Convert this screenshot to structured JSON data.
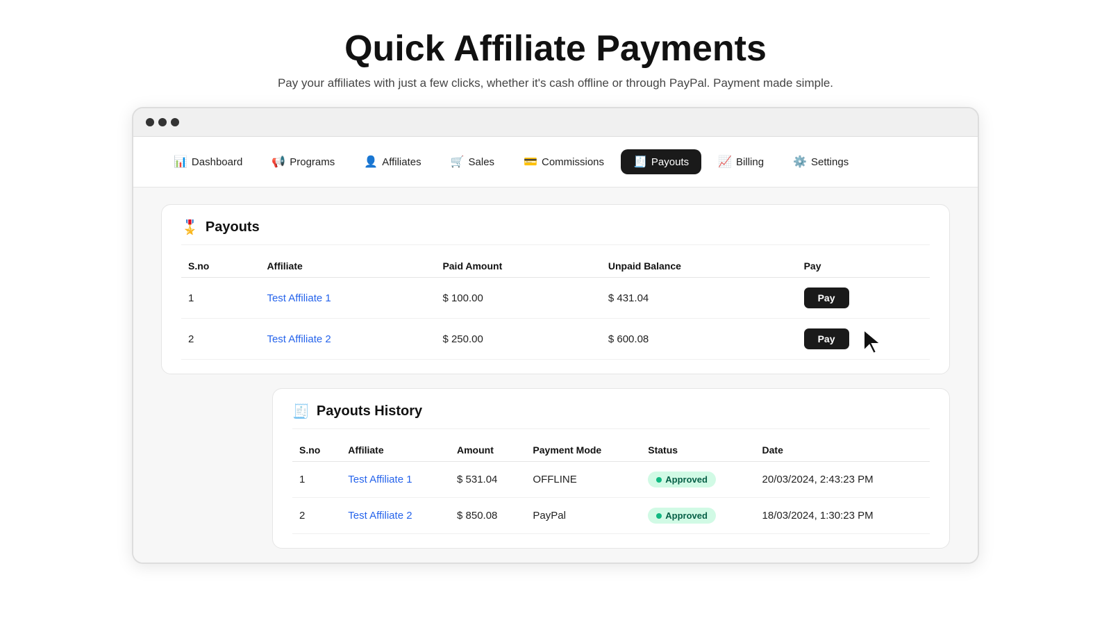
{
  "header": {
    "title": "Quick Affiliate Payments",
    "subtitle": "Pay your affiliates with just a few clicks, whether it's cash offline or through PayPal. Payment made simple."
  },
  "nav": {
    "items": [
      {
        "id": "dashboard",
        "label": "Dashboard",
        "icon": "📊",
        "active": false
      },
      {
        "id": "programs",
        "label": "Programs",
        "icon": "📢",
        "active": false
      },
      {
        "id": "affiliates",
        "label": "Affiliates",
        "icon": "👤",
        "active": false
      },
      {
        "id": "sales",
        "label": "Sales",
        "icon": "🛒",
        "active": false
      },
      {
        "id": "commissions",
        "label": "Commissions",
        "icon": "💳",
        "active": false
      },
      {
        "id": "payouts",
        "label": "Payouts",
        "icon": "🧾",
        "active": true
      },
      {
        "id": "billing",
        "label": "Billing",
        "icon": "📈",
        "active": false
      },
      {
        "id": "settings",
        "label": "Settings",
        "icon": "⚙️",
        "active": false
      }
    ]
  },
  "payouts": {
    "section_title": "Payouts",
    "columns": [
      "S.no",
      "Affiliate",
      "Paid Amount",
      "Unpaid Balance",
      "Pay"
    ],
    "rows": [
      {
        "sno": "1",
        "affiliate": "Test Affiliate 1",
        "affiliate_href": "#",
        "paid_amount": "$ 100.00",
        "unpaid_balance": "$ 431.04",
        "pay_label": "Pay"
      },
      {
        "sno": "2",
        "affiliate": "Test Affiliate 2",
        "affiliate_href": "#",
        "paid_amount": "$ 250.00",
        "unpaid_balance": "$ 600.08",
        "pay_label": "Pay"
      }
    ]
  },
  "payouts_history": {
    "section_title": "Payouts History",
    "columns": [
      "S.no",
      "Affiliate",
      "Amount",
      "Payment Mode",
      "Status",
      "Date"
    ],
    "rows": [
      {
        "sno": "1",
        "affiliate": "Test Affiliate 1",
        "affiliate_href": "#",
        "amount": "$ 531.04",
        "payment_mode": "OFFLINE",
        "status": "Approved",
        "date": "20/03/2024, 2:43:23 PM"
      },
      {
        "sno": "2",
        "affiliate": "Test Affiliate 2",
        "affiliate_href": "#",
        "amount": "$ 850.08",
        "payment_mode": "PayPal",
        "status": "Approved",
        "date": "18/03/2024, 1:30:23 PM"
      }
    ]
  }
}
